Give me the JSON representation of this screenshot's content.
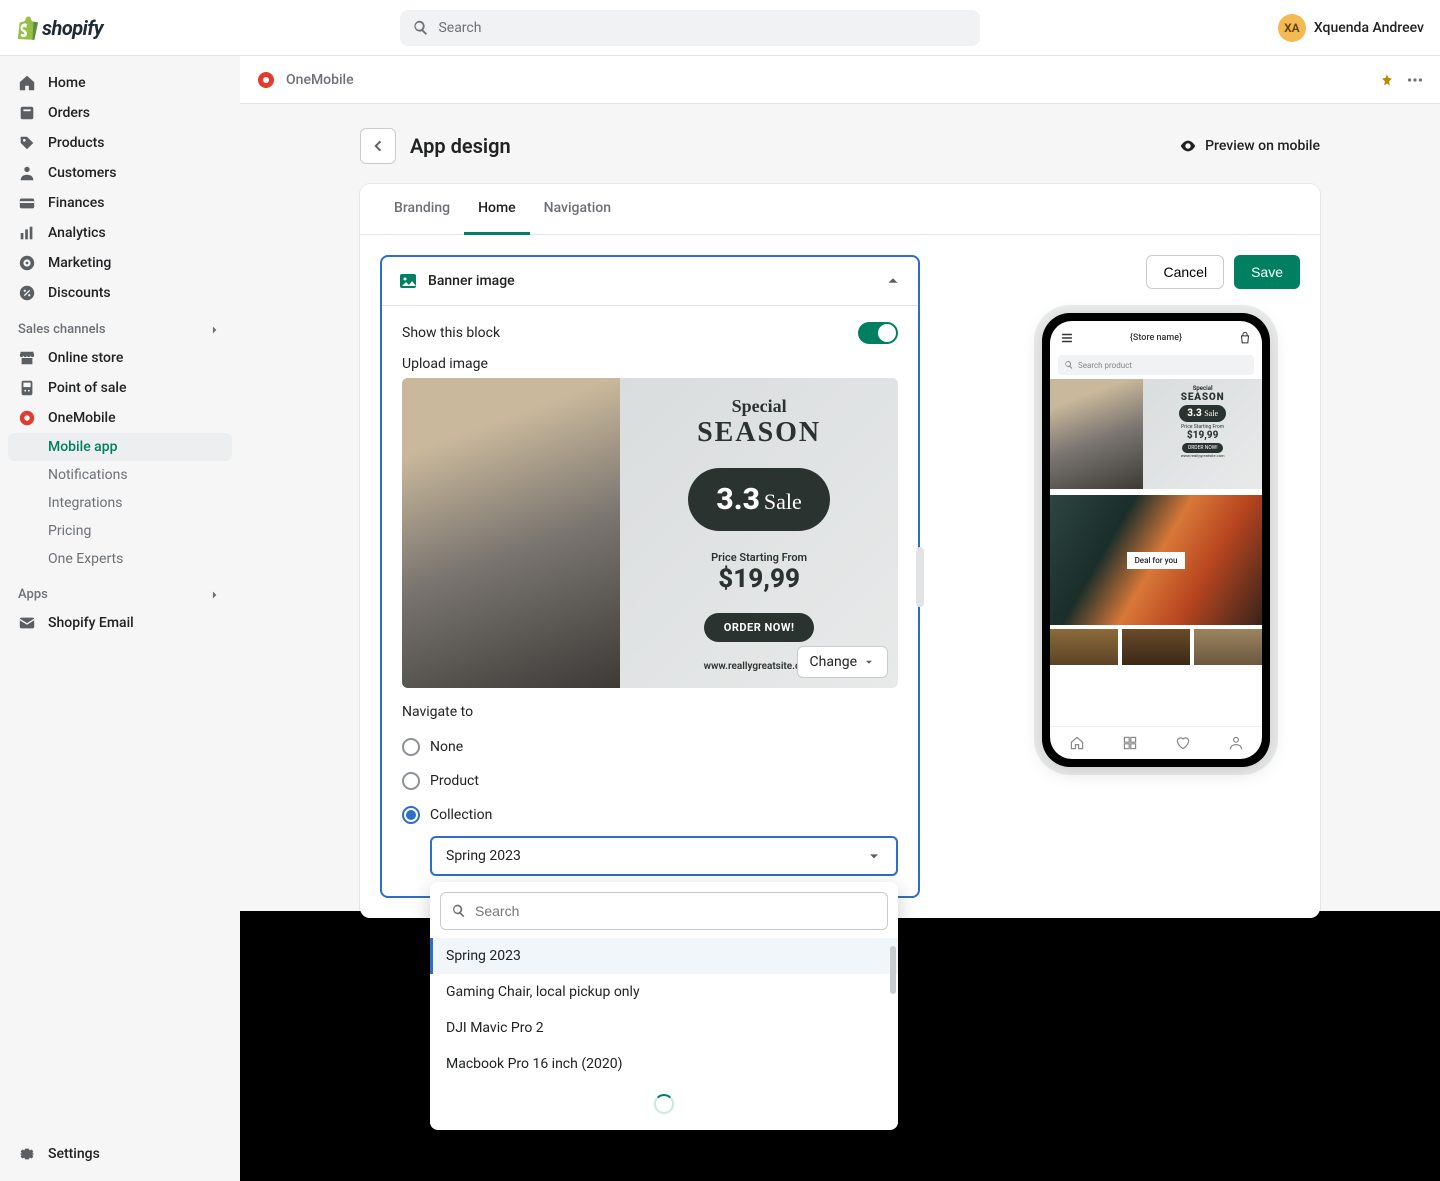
{
  "header": {
    "brand": "shopify",
    "search_placeholder": "Search",
    "user_initials": "XA",
    "user_name": "Xquenda Andreev"
  },
  "sidebar": {
    "items": [
      {
        "label": "Home"
      },
      {
        "label": "Orders"
      },
      {
        "label": "Products"
      },
      {
        "label": "Customers"
      },
      {
        "label": "Finances"
      },
      {
        "label": "Analytics"
      },
      {
        "label": "Marketing"
      },
      {
        "label": "Discounts"
      }
    ],
    "sales_channels_label": "Sales channels",
    "channels": [
      {
        "label": "Online store"
      },
      {
        "label": "Point of sale"
      },
      {
        "label": "OneMobile"
      }
    ],
    "onemobile_sub": [
      {
        "label": "Mobile app"
      },
      {
        "label": "Notifications"
      },
      {
        "label": "Integrations"
      },
      {
        "label": "Pricing"
      },
      {
        "label": "One Experts"
      }
    ],
    "apps_label": "Apps",
    "apps": [
      {
        "label": "Shopify Email"
      }
    ],
    "settings_label": "Settings"
  },
  "app_bar": {
    "title": "OneMobile"
  },
  "page": {
    "title": "App design",
    "preview_label": "Preview on mobile",
    "tabs": [
      "Branding",
      "Home",
      "Navigation"
    ],
    "active_tab": "Home",
    "cancel": "Cancel",
    "save": "Save"
  },
  "block": {
    "title": "Banner image",
    "show_label": "Show this block",
    "upload_label": "Upload image",
    "change_label": "Change",
    "navigate_label": "Navigate to",
    "options": [
      "None",
      "Product",
      "Collection"
    ],
    "selected_option": "Collection",
    "selected_value": "Spring 2023"
  },
  "banner": {
    "special": "Special",
    "season": "SEASON",
    "sale_number": "3.3",
    "sale_script": "Sale",
    "price_from": "Price Starting From",
    "price": "$19,99",
    "order": "ORDER NOW!",
    "site": "www.reallygreatsite.com"
  },
  "dropdown": {
    "search_placeholder": "Search",
    "items": [
      "Spring 2023",
      "Gaming Chair, local pickup only",
      "DJI Mavic Pro 2",
      "Macbook Pro 16 inch (2020)"
    ]
  },
  "phone": {
    "store_name": "{Store name}",
    "search_placeholder": "Search product",
    "deal_tag": "Deal for you"
  }
}
